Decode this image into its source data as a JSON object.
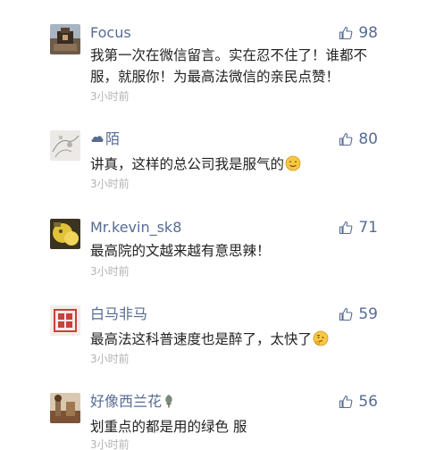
{
  "comments": [
    {
      "nickname": "Focus",
      "likes": "98",
      "content": "我第一次在微信留言。实在忍不住了！谁都不服，就服你！为最高法微信的亲民点赞！",
      "time": "3小时前",
      "avatar_icon": "avatar-photo-focus"
    },
    {
      "nickname_prefix_icon": "cloud-icon",
      "nickname": "陌",
      "likes": "80",
      "content": "讲真，这样的总公司我是服气的",
      "content_emoji": "smile-emoji-icon",
      "time": "3小时前",
      "avatar_icon": "avatar-photo-sketch"
    },
    {
      "nickname": "Mr.kevin_sk8",
      "likes": "71",
      "content": "最高院的文越来越有意思辣！",
      "time": "3小时前",
      "avatar_icon": "avatar-photo-yellow"
    },
    {
      "nickname": "白马非马",
      "likes": "59",
      "content": "最高法这科普速度也是醉了，太快了",
      "content_emoji": "thinking-emoji-icon",
      "time": "3小时前",
      "avatar_icon": "avatar-seal-red"
    },
    {
      "nickname": "好像西兰花",
      "nickname_suffix_icon": "tree-icon",
      "likes": "56",
      "content": "划重点的都是用的绿色 服",
      "time": "3小时前",
      "avatar_icon": "avatar-photo-brown"
    }
  ],
  "colors": {
    "nickname": "#576b95",
    "like": "#576b95",
    "content": "#222222",
    "time": "#b2b2b2"
  }
}
